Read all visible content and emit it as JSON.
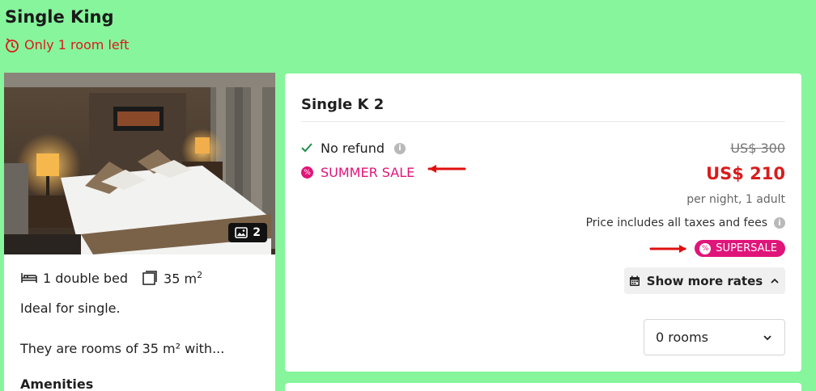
{
  "room": {
    "title": "Single King",
    "scarcity": "Only 1 room left"
  },
  "left_card": {
    "photo_count": "2",
    "bed": "1 double bed",
    "size_value": "35 m",
    "size_unit_exp": "2",
    "description": "Ideal for single.",
    "summary": "They are rooms of 35 m² with...",
    "amenities_heading": "Amenities"
  },
  "rate": {
    "name": "Single K 2",
    "policy": "No refund",
    "promo": "SUMMER SALE",
    "price_old": "US$ 300",
    "price_new": "US$ 210",
    "per_night": "per night, 1 adult",
    "taxes": "Price includes all taxes and fees",
    "badge": "SUPERSALE",
    "more_rates": "Show more rates",
    "rooms_value": "0 rooms"
  },
  "colors": {
    "background": "#86f59c",
    "price": "#d91c1c",
    "promo": "#e0157a",
    "arrow": "#e01010"
  },
  "icons": {
    "scarcity": "timer-icon",
    "photo": "image-icon",
    "bed": "bed-icon",
    "size": "room-size-icon",
    "check": "check-icon",
    "info": "info-icon",
    "promo": "discount-icon",
    "calendar": "calendar-icon",
    "chevron_up": "chevron-up-icon",
    "chevron_down": "chevron-down-icon"
  }
}
